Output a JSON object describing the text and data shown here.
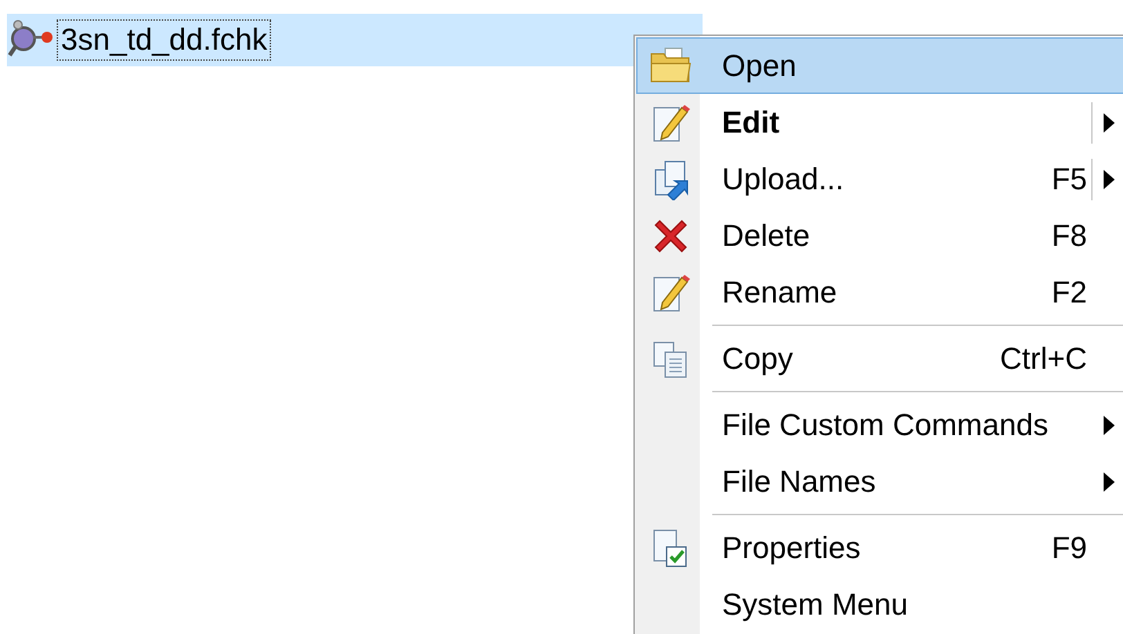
{
  "file_list": {
    "rows": [
      {
        "name": "3sn_td_dd.fchk",
        "selected": true
      }
    ]
  },
  "context_menu": {
    "items": [
      {
        "kind": "item",
        "label": "Open",
        "selected": true,
        "default": false,
        "submenu": false,
        "split": false
      },
      {
        "kind": "item",
        "label": "Edit",
        "selected": false,
        "default": true,
        "submenu": true,
        "split": true
      },
      {
        "kind": "item",
        "label": "Upload...",
        "shortcut": "F5",
        "selected": false,
        "default": false,
        "submenu": true,
        "split": true
      },
      {
        "kind": "item",
        "label": "Delete",
        "shortcut": "F8",
        "selected": false,
        "default": false,
        "submenu": false,
        "split": false
      },
      {
        "kind": "item",
        "label": "Rename",
        "shortcut": "F2",
        "selected": false,
        "default": false,
        "submenu": false,
        "split": false
      },
      {
        "kind": "separator"
      },
      {
        "kind": "item",
        "label": "Copy",
        "shortcut": "Ctrl+C",
        "selected": false,
        "default": false,
        "submenu": false,
        "split": false
      },
      {
        "kind": "separator"
      },
      {
        "kind": "item",
        "label": "File Custom Commands",
        "selected": false,
        "default": false,
        "submenu": true,
        "split": false
      },
      {
        "kind": "item",
        "label": "File Names",
        "selected": false,
        "default": false,
        "submenu": true,
        "split": false
      },
      {
        "kind": "separator"
      },
      {
        "kind": "item",
        "label": "Properties",
        "shortcut": "F9",
        "selected": false,
        "default": false,
        "submenu": false,
        "split": false
      },
      {
        "kind": "item",
        "label": "System Menu",
        "selected": false,
        "default": false,
        "submenu": false,
        "split": false
      }
    ]
  }
}
